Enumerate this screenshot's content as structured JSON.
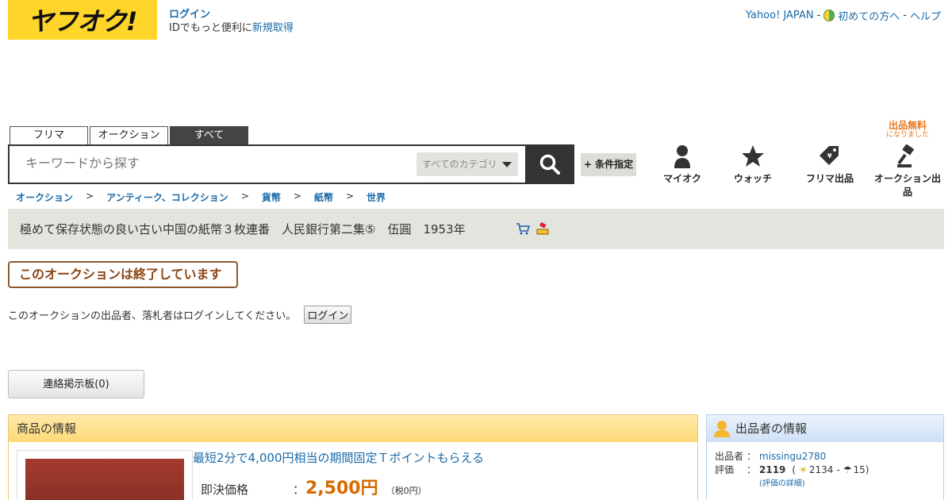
{
  "header": {
    "logo_text": "ヤフオク!",
    "login_link": "ログイン",
    "login_sub_text": "IDでもっと便利に",
    "register_link": "新規取得",
    "top_links": {
      "yahoo_japan": "Yahoo! JAPAN",
      "first_time": "初めての方へ",
      "help": "ヘルプ",
      "sep": "-"
    }
  },
  "search": {
    "tabs": [
      "フリマ",
      "オークション",
      "すべて"
    ],
    "active_tab": "すべて",
    "placeholder": "キーワードから探す",
    "category": "すべてのカテゴリ",
    "condition_button": "+ 条件指定"
  },
  "nav": {
    "free_badge": "出品無料",
    "free_badge_sub": "になりました",
    "items": [
      "マイオク",
      "ウォッチ",
      "フリマ出品",
      "オークション出品"
    ]
  },
  "breadcrumb": [
    "オークション",
    "アンティーク、コレクション",
    "貨幣",
    "紙幣",
    "世界"
  ],
  "breadcrumb_sep": ">",
  "item": {
    "title": "極めて保存状態の良い古い中国の紙幣３枚連番　人民銀行第二集⑤　伍圓　1953年",
    "ended_notice": "このオークションは終了しています",
    "login_notice": "このオークションの出品者、落札者はログインしてください。",
    "login_button": "ログイン",
    "board_button": "連絡掲示板(0)"
  },
  "product_info": {
    "heading": "商品の情報",
    "promo": "最短2分で4,000円相当の期間固定Ｔポイントもらえる",
    "price_label": "即決価格",
    "colon": "：",
    "price": "2,500円",
    "tax": "（税0円）"
  },
  "seller": {
    "heading": "出品者の情報",
    "seller_label": "出品者",
    "seller_name": "missingu2780",
    "rating_label": "評価",
    "colon": "：",
    "rating_total": "2119",
    "rating_good": "2134",
    "rating_bad": "15",
    "rating_detail": "(評価の詳細)"
  }
}
